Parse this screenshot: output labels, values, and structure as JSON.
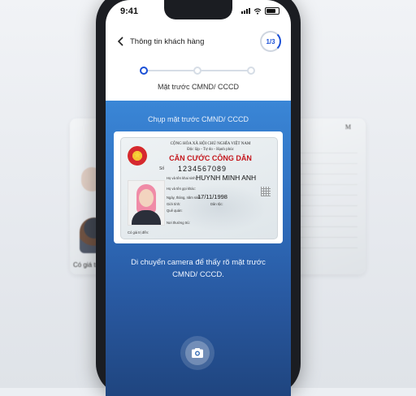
{
  "status_bar": {
    "time": "9:41"
  },
  "header": {
    "back_icon": "chevron-left-icon",
    "title": "Thông tin khách hàng",
    "step": "1/3"
  },
  "progress": {
    "current_step": 1,
    "total_steps": 3,
    "step_label": "Mặt trước CMND/ CCCD"
  },
  "camera": {
    "title": "Chụp mặt trước CMND/ CCCD",
    "hint": "Di chuyển camera để thấy rõ mặt trước CMND/ CCCD.",
    "capture_icon": "camera-icon"
  },
  "id_card": {
    "republic": "CỘNG HÒA XÃ HỘI CHỦ NGHĨA VIỆT NAM",
    "motto": "Độc lập - Tự do - Hạnh phúc",
    "type": "CĂN CƯỚC CÔNG DÂN",
    "so_label": "Số",
    "number": "1234567089",
    "name_label": "Họ và tên khai sinh:",
    "name": "HUYNH MINH ANH",
    "alias_label": "Họ và tên gọi khác:",
    "dob_label": "Ngày, tháng, năm sinh:",
    "dob": "17/11/1998",
    "sex_label": "Giới tính:",
    "ethnic_label": "Dân tộc:",
    "hometown_label": "Quê quán:",
    "residence_label": "Nơi thường trú:",
    "expiry_label": "Có giá trị đến:"
  },
  "side_cards": {
    "left_label": "Có giá tr",
    "right_mark": "M"
  }
}
